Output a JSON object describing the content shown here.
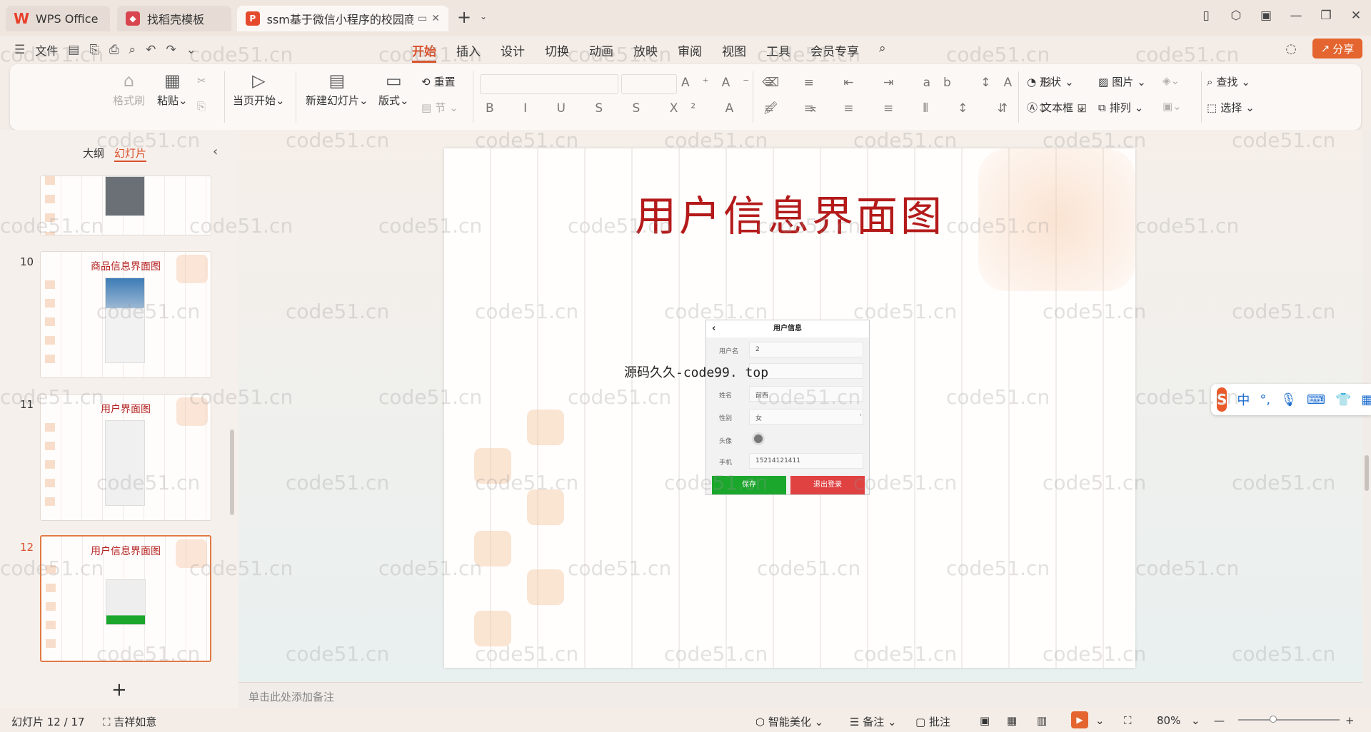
{
  "tabs": [
    {
      "label": "WPS Office",
      "icon": "wps-logo-icon"
    },
    {
      "label": "找稻壳模板",
      "icon": "docer-icon"
    },
    {
      "label": "ssm基于微信小程序的校园商",
      "icon": "ppt-icon"
    }
  ],
  "menubar": {
    "file_label": "文件",
    "menus": [
      "开始",
      "插入",
      "设计",
      "切换",
      "动画",
      "放映",
      "审阅",
      "视图",
      "工具",
      "会员专享"
    ],
    "share_label": "分享"
  },
  "ribbon": {
    "format_painter": "格式刷",
    "paste": "粘贴",
    "from_current": "当页开始",
    "new_slide": "新建幻灯片",
    "layout": "版式",
    "reset": "重置",
    "section": "节",
    "shape": "形状",
    "picture": "图片",
    "find": "查找",
    "textbox": "文本框",
    "arrange": "排列",
    "select": "选择"
  },
  "left_panel": {
    "tab_outline": "大纲",
    "tab_slides": "幻灯片",
    "thumbnails": [
      {
        "num": "10",
        "title": "商品信息界面图"
      },
      {
        "num": "11",
        "title": "用户界面图"
      },
      {
        "num": "12",
        "title": "用户信息界面图"
      }
    ]
  },
  "slide": {
    "title": "用户信息界面图",
    "overlay_text": "源码久久-code99. top",
    "phone": {
      "header": "用户信息",
      "rows": [
        {
          "label": "用户名",
          "value": "2"
        },
        {
          "label": "",
          "value": ""
        },
        {
          "label": "姓名",
          "value": "前西"
        },
        {
          "label": "性别",
          "value": "女"
        },
        {
          "label": "头像",
          "value": ""
        },
        {
          "label": "手机",
          "value": "15214121411"
        }
      ],
      "save": "保存",
      "logout": "退出登录"
    }
  },
  "notes_placeholder": "单击此处添加备注",
  "status": {
    "slide_counter": "幻灯片 12 / 17",
    "theme": "吉祥如意",
    "smart_beautify": "智能美化",
    "notes": "备注",
    "comments": "批注",
    "zoom": "80%"
  },
  "watermark": "code51.cn",
  "colors": {
    "accent": "#d9502a",
    "title_red": "#b41a1a",
    "share_orange": "#e4652f"
  }
}
